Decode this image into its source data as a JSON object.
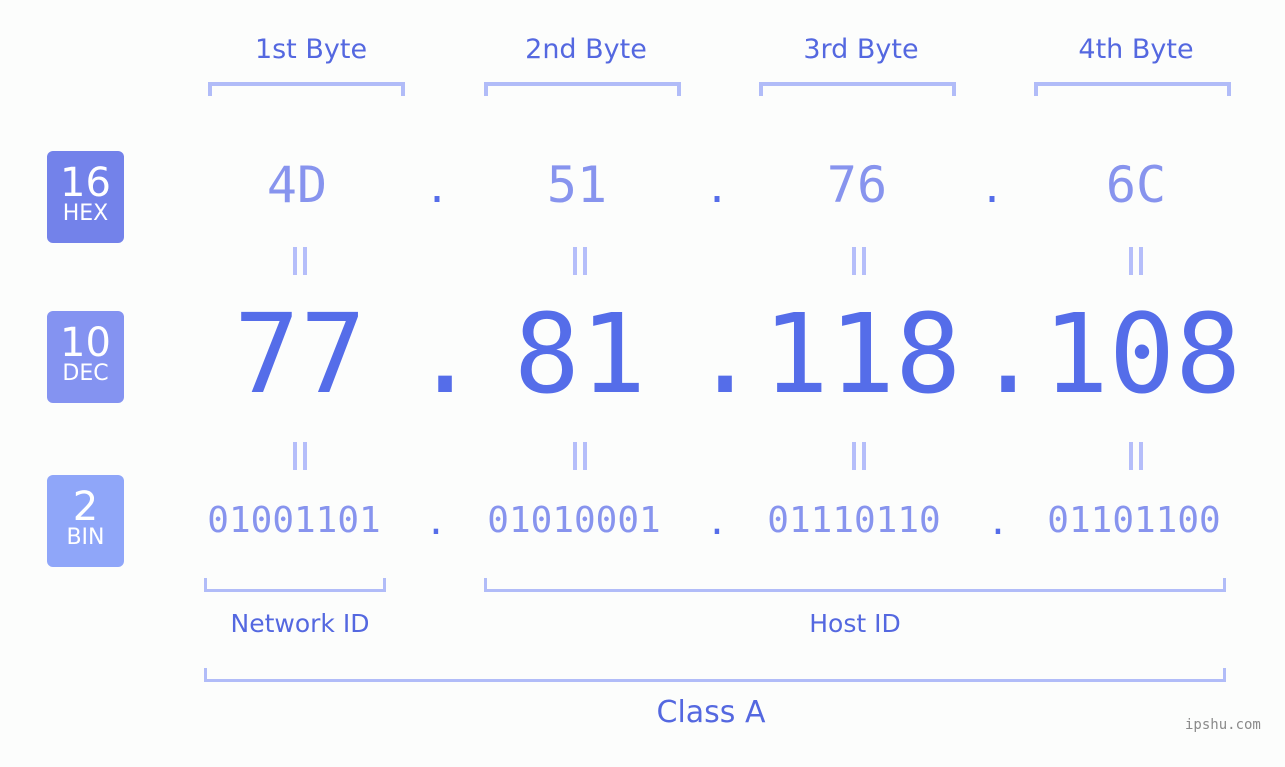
{
  "ip": {
    "bytes": [
      {
        "label": "1st Byte",
        "hex": "4D",
        "dec": "77",
        "bin": "01001101"
      },
      {
        "label": "2nd Byte",
        "hex": "51",
        "dec": "81",
        "bin": "01010001"
      },
      {
        "label": "3rd Byte",
        "hex": "76",
        "dec": "118",
        "bin": "01110110"
      },
      {
        "label": "4th Byte",
        "hex": "6C",
        "dec": "108",
        "bin": "01101100"
      }
    ],
    "separator": "."
  },
  "bases": [
    {
      "num": "16",
      "label": "HEX",
      "color": "#7382ea"
    },
    {
      "num": "10",
      "label": "DEC",
      "color": "#8493f1"
    },
    {
      "num": "2",
      "label": "BIN",
      "color": "#8fa6f9"
    }
  ],
  "segments": {
    "network": "Network ID",
    "host": "Host ID",
    "class": "Class A"
  },
  "watermark": "ipshu.com",
  "colors": {
    "accent": "#556de9",
    "light": "#8794ee",
    "bracket": "#b1bcf8",
    "background": "#fcfdfc"
  }
}
